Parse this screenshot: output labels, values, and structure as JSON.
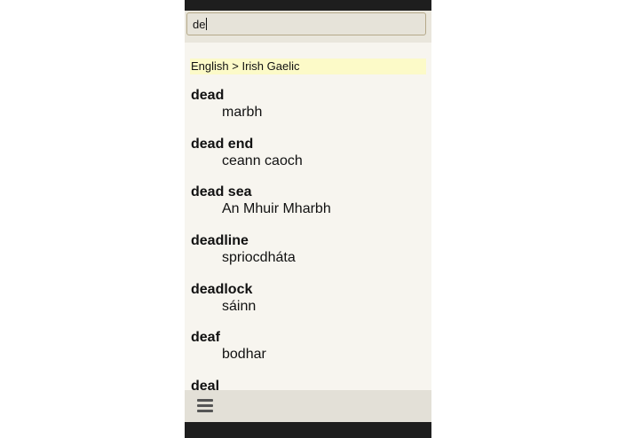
{
  "search": {
    "value": "de"
  },
  "direction": {
    "label": "English > Irish Gaelic"
  },
  "entries": [
    {
      "headword": "dead",
      "translation": "marbh"
    },
    {
      "headword": "dead end",
      "translation": "ceann caoch"
    },
    {
      "headword": "dead sea",
      "translation": "An Mhuir Mharbh"
    },
    {
      "headword": "deadline",
      "translation": "spriocdháta"
    },
    {
      "headword": "deadlock",
      "translation": "sáinn"
    },
    {
      "headword": "deaf",
      "translation": "bodhar"
    },
    {
      "headword": "deal",
      "translation": ""
    }
  ],
  "toolbar": {
    "menu_icon": "hamburger-menu-icon"
  },
  "colors": {
    "screen_bg": "#f7f5ef",
    "search_border": "#b5a98a",
    "language_bar": "#fcfac8",
    "bottom_bar": "#e3e0d7",
    "device_frame": "#1e1e1e"
  }
}
